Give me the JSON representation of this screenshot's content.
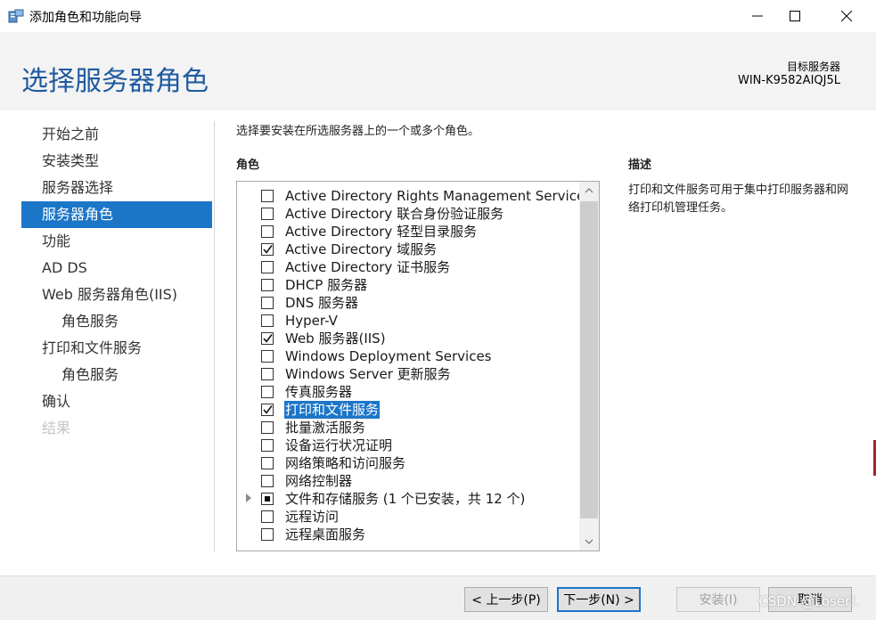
{
  "window": {
    "title": "添加角色和功能向导"
  },
  "header": {
    "page_title": "选择服务器角色",
    "dest_label": "目标服务器",
    "dest_value": "WIN-K9582AIQJ5L"
  },
  "nav": {
    "items": [
      {
        "label": "开始之前",
        "state": "normal"
      },
      {
        "label": "安装类型",
        "state": "normal"
      },
      {
        "label": "服务器选择",
        "state": "normal"
      },
      {
        "label": "服务器角色",
        "state": "active"
      },
      {
        "label": "功能",
        "state": "normal"
      },
      {
        "label": "AD DS",
        "state": "normal"
      },
      {
        "label": "Web 服务器角色(IIS)",
        "state": "normal"
      },
      {
        "label": "角色服务",
        "state": "sub"
      },
      {
        "label": "打印和文件服务",
        "state": "normal"
      },
      {
        "label": "角色服务",
        "state": "sub"
      },
      {
        "label": "确认",
        "state": "normal"
      },
      {
        "label": "结果",
        "state": "disabled"
      }
    ]
  },
  "main": {
    "instruction": "选择要安装在所选服务器上的一个或多个角色。",
    "roles_heading": "角色",
    "description_heading": "描述",
    "description_text": "打印和文件服务可用于集中打印服务器和网络打印机管理任务。",
    "roles": [
      {
        "label": "Active Directory Rights Management Services",
        "checked": "no"
      },
      {
        "label": "Active Directory 联合身份验证服务",
        "checked": "no"
      },
      {
        "label": "Active Directory 轻型目录服务",
        "checked": "no"
      },
      {
        "label": "Active Directory 域服务",
        "checked": "yes"
      },
      {
        "label": "Active Directory 证书服务",
        "checked": "no"
      },
      {
        "label": "DHCP 服务器",
        "checked": "no"
      },
      {
        "label": "DNS 服务器",
        "checked": "no"
      },
      {
        "label": "Hyper-V",
        "checked": "no"
      },
      {
        "label": "Web 服务器(IIS)",
        "checked": "yes"
      },
      {
        "label": "Windows Deployment Services",
        "checked": "no"
      },
      {
        "label": "Windows Server 更新服务",
        "checked": "no"
      },
      {
        "label": "传真服务器",
        "checked": "no"
      },
      {
        "label": "打印和文件服务",
        "checked": "yes",
        "selected": true
      },
      {
        "label": "批量激活服务",
        "checked": "no"
      },
      {
        "label": "设备运行状况证明",
        "checked": "no"
      },
      {
        "label": "网络策略和访问服务",
        "checked": "no"
      },
      {
        "label": "网络控制器",
        "checked": "no"
      },
      {
        "label": "文件和存储服务 (1 个已安装，共 12 个)",
        "checked": "partial",
        "expandable": true
      },
      {
        "label": "远程访问",
        "checked": "no"
      },
      {
        "label": "远程桌面服务",
        "checked": "no"
      }
    ]
  },
  "footer": {
    "prev_label": "< 上一步(P)",
    "next_label": "下一步(N) >",
    "install_label": "安装(I)",
    "cancel_label": "取消"
  },
  "watermark": "CSDN @Loser!.",
  "colors": {
    "accent": "#1c76c8",
    "title_blue": "#1e5aa0",
    "header_bg": "#f3f3f3"
  }
}
